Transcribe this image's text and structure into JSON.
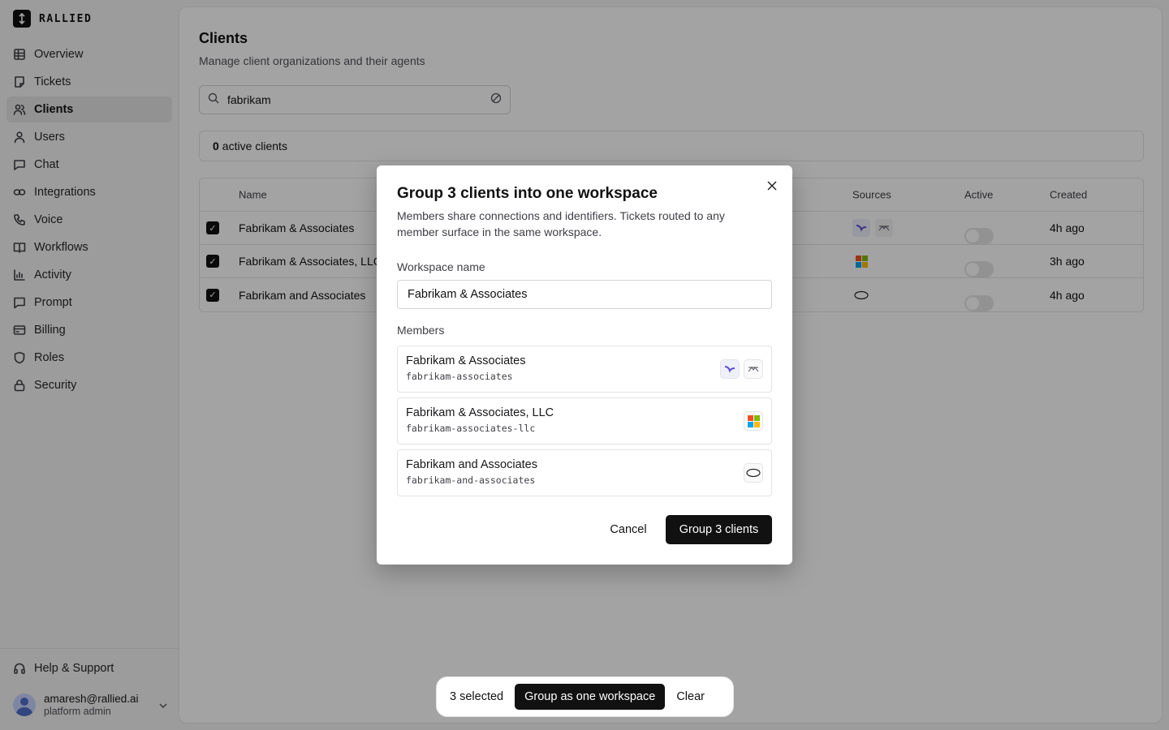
{
  "brand": {
    "name": "RALLIED"
  },
  "sidebar": {
    "items": [
      {
        "label": "Overview",
        "icon": "grid-icon"
      },
      {
        "label": "Tickets",
        "icon": "ticket-icon"
      },
      {
        "label": "Clients",
        "icon": "users-icon",
        "active": true
      },
      {
        "label": "Users",
        "icon": "user-icon"
      },
      {
        "label": "Chat",
        "icon": "chat-icon"
      },
      {
        "label": "Integrations",
        "icon": "link-icon"
      },
      {
        "label": "Voice",
        "icon": "phone-icon"
      },
      {
        "label": "Workflows",
        "icon": "book-icon"
      },
      {
        "label": "Activity",
        "icon": "bar-chart-icon"
      },
      {
        "label": "Prompt",
        "icon": "message-icon"
      },
      {
        "label": "Billing",
        "icon": "card-icon"
      },
      {
        "label": "Roles",
        "icon": "shield-icon"
      },
      {
        "label": "Security",
        "icon": "lock-icon"
      }
    ],
    "help": "Help & Support",
    "user": {
      "email": "amaresh@rallied.ai",
      "role": "platform admin"
    }
  },
  "page": {
    "title": "Clients",
    "subtitle": "Manage client organizations and their agents",
    "search_value": "fabrikam",
    "summary_count": "0",
    "summary_label": "active clients"
  },
  "table": {
    "headers": {
      "name": "Name",
      "sources": "Sources",
      "active": "Active",
      "created": "Created"
    },
    "rows": [
      {
        "name": "Fabrikam & Associates",
        "created": "4h ago",
        "sources": [
          "zendesk-icon",
          "freshdesk-icon"
        ],
        "checked": true,
        "active": false
      },
      {
        "name": "Fabrikam & Associates, LLC",
        "created": "3h ago",
        "sources": [
          "microsoft-icon"
        ],
        "checked": true,
        "active": false
      },
      {
        "name": "Fabrikam and Associates",
        "created": "4h ago",
        "sources": [
          "cloud-icon"
        ],
        "checked": true,
        "active": false
      }
    ]
  },
  "modal": {
    "title": "Group 3 clients into one workspace",
    "description": "Members share connections and identifiers. Tickets routed to any member surface in the same workspace.",
    "workspace_label": "Workspace name",
    "workspace_value": "Fabrikam & Associates",
    "members_label": "Members",
    "members": [
      {
        "name": "Fabrikam & Associates",
        "slug": "fabrikam-associates",
        "icons": [
          "zendesk-icon",
          "freshdesk-icon"
        ]
      },
      {
        "name": "Fabrikam & Associates, LLC",
        "slug": "fabrikam-associates-llc",
        "icons": [
          "microsoft-icon"
        ]
      },
      {
        "name": "Fabrikam and Associates",
        "slug": "fabrikam-and-associates",
        "icons": [
          "cloud-icon"
        ]
      }
    ],
    "cancel_label": "Cancel",
    "confirm_label": "Group 3 clients"
  },
  "bulkbar": {
    "count_label": "3 selected",
    "group_label": "Group as one workspace",
    "clear_label": "Clear"
  },
  "colors": {
    "primary": "#111111",
    "accent_purple": "#5b4bd6",
    "overlay": "rgba(0,0,0,0.36)"
  }
}
